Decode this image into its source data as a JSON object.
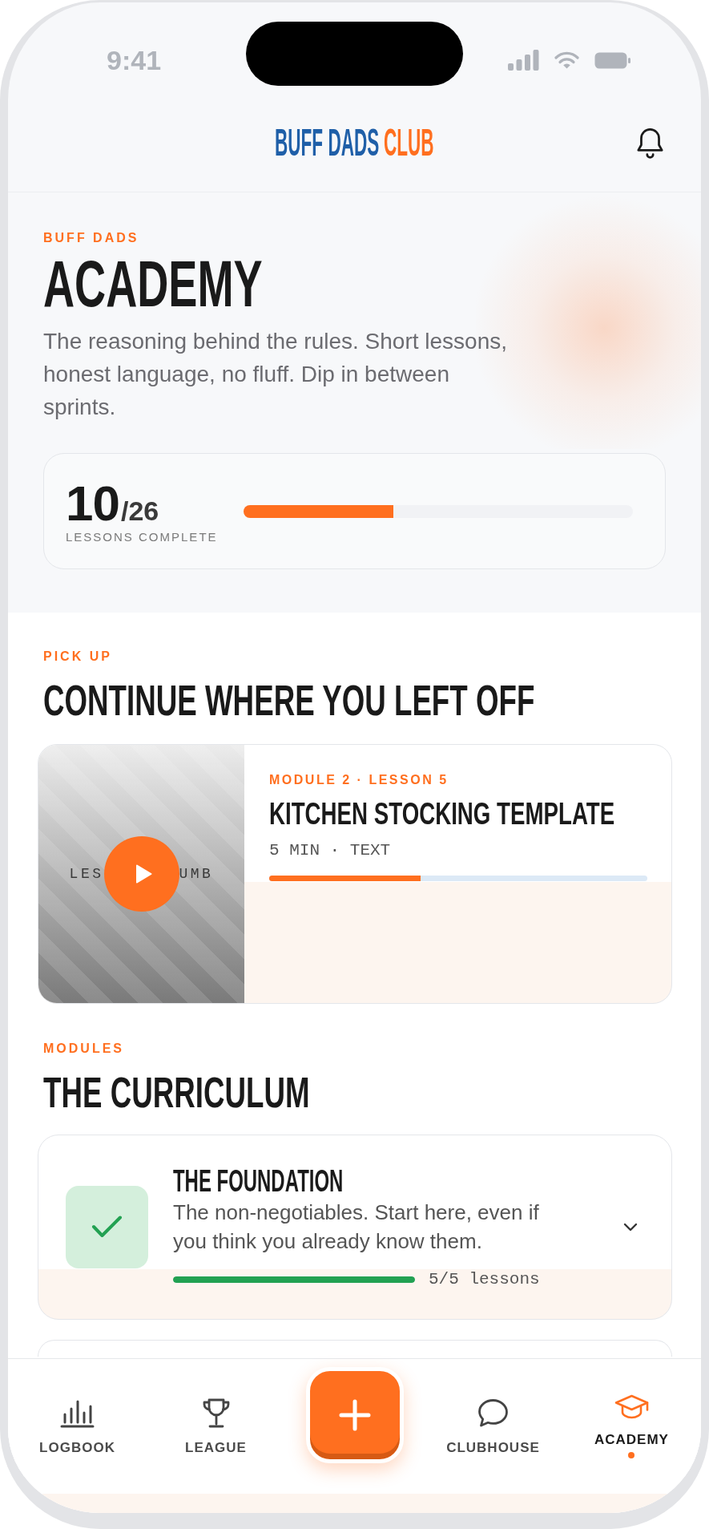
{
  "status_bar": {
    "time": "9:41"
  },
  "header": {
    "logo": {
      "primary": "BUFF DADS",
      "accent": "CLUB"
    }
  },
  "hero": {
    "eyebrow": "BUFF DADS",
    "title": "ACADEMY",
    "description": "The reasoning behind the rules. Short lessons, honest language, no fluff. Dip in between sprints.",
    "glow": true,
    "progress": {
      "completed": "10",
      "total": "/26",
      "label": "LESSONS COMPLETE",
      "level": 0.385
    }
  },
  "continue_section": {
    "eyebrow": "PICK UP",
    "title": "CONTINUE WHERE YOU LEFT OFF",
    "lesson": {
      "thumbnail_text_left": "LES",
      "thumbnail_text_right": "UMB",
      "meta": "MODULE 2 · LESSON 5",
      "title": "KITCHEN STOCKING TEMPLATE",
      "details": "5 MIN · TEXT",
      "level": 0.4
    }
  },
  "curriculum": {
    "eyebrow": "MODULES",
    "title": "THE CURRICULUM",
    "modules": [
      {
        "title": "THE FOUNDATION",
        "description": "The non-negotiables. Start here, even if you think you already know them.",
        "progress_text": "5/5 lessons",
        "level": 1,
        "completed": true,
        "expanded": false
      }
    ],
    "more_below": true
  },
  "bottom_nav": {
    "items": [
      {
        "kind": "logbook",
        "label": "LOGBOOK",
        "selected": false
      },
      {
        "kind": "league",
        "label": "LEAGUE",
        "selected": false
      },
      {
        "kind": "add",
        "selected": false
      },
      {
        "kind": "clubhouse",
        "label": "CLUBHOUSE",
        "selected": false
      },
      {
        "kind": "academy",
        "label": "ACADEMY",
        "selected": true
      }
    ]
  }
}
